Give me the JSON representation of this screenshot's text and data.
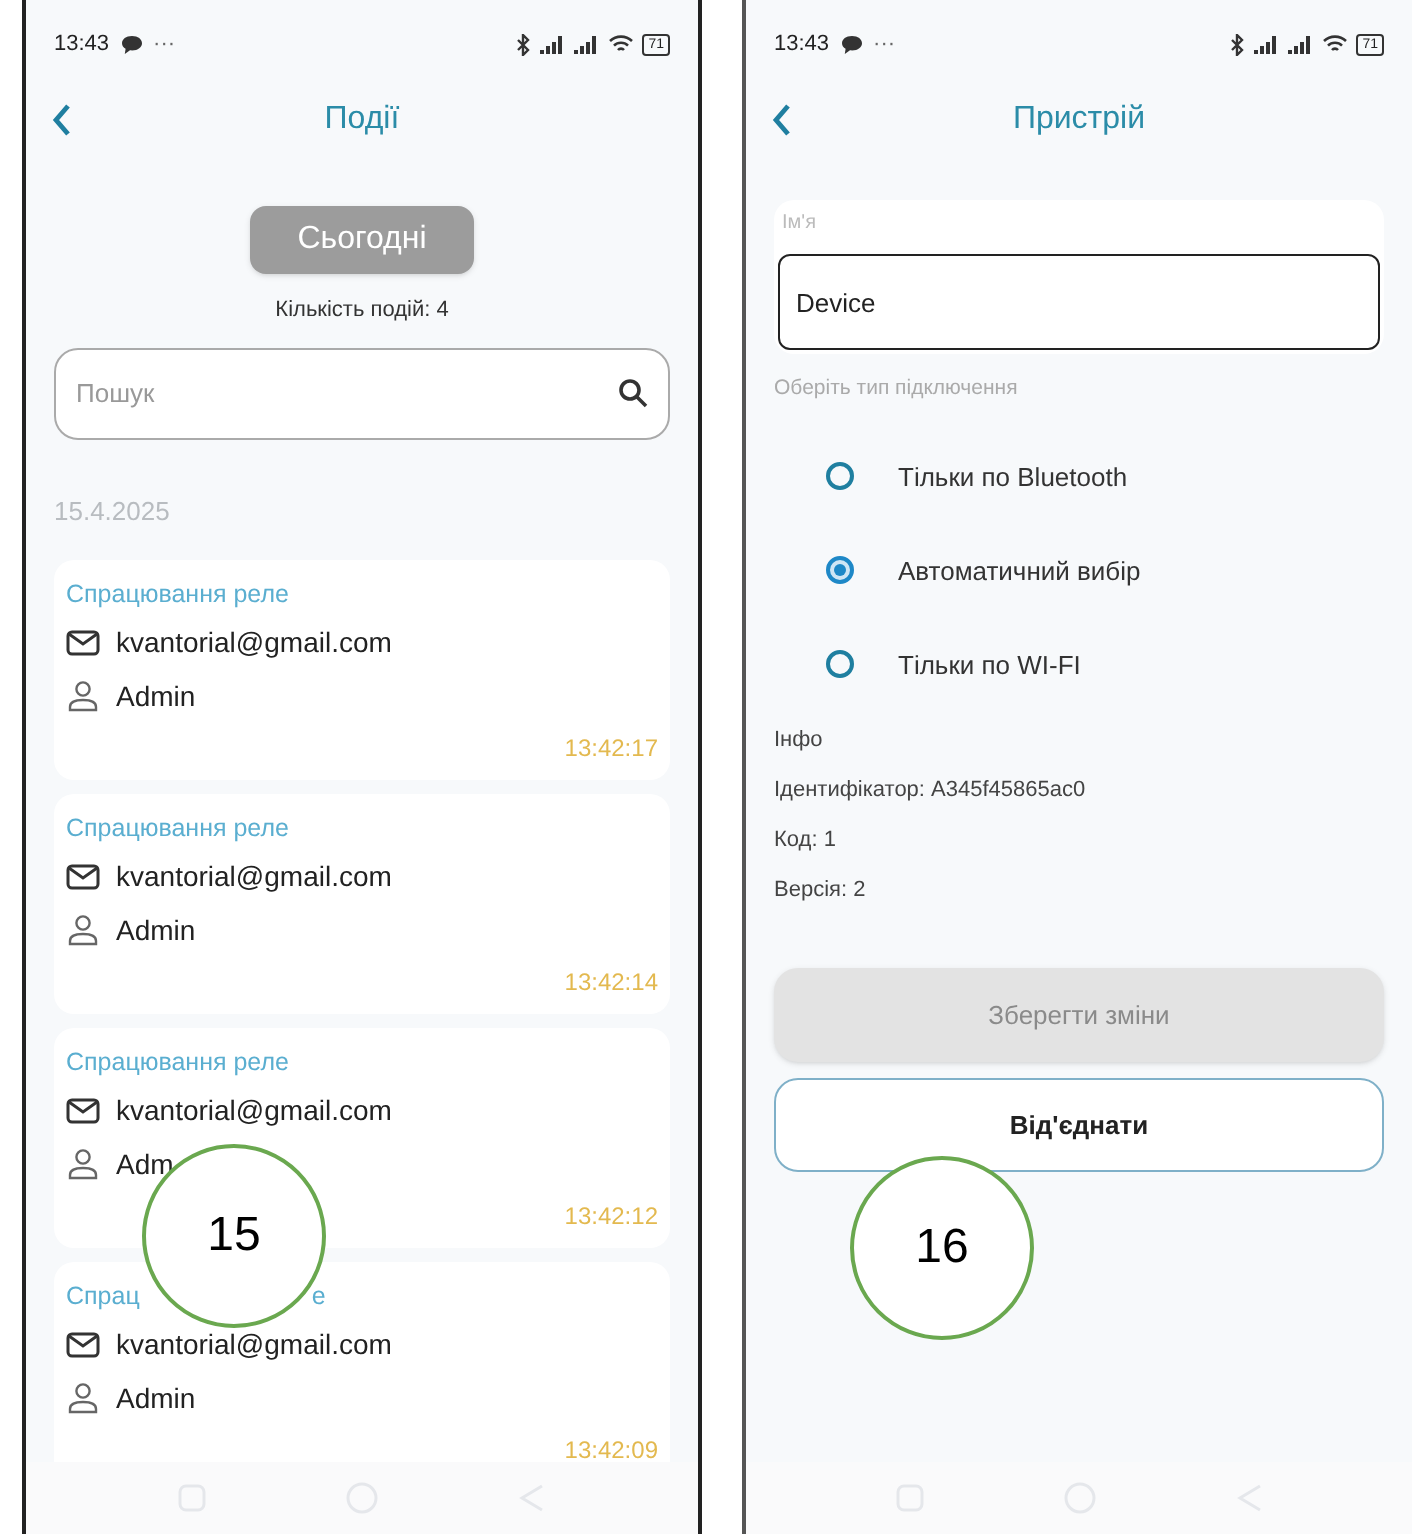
{
  "screens": [
    {
      "kind": "events",
      "status": {
        "time": "13:43",
        "more": "···",
        "battery": "71"
      },
      "title": "Події",
      "today_button": "Сьогодні",
      "count": "Кількість подій: 4",
      "search": {
        "placeholder": "Пошук"
      },
      "date": "15.4.2025",
      "events": [
        {
          "title": "Спрацювання реле",
          "email": "kvantorial@gmail.com",
          "user": "Admin",
          "time": "13:42:17"
        },
        {
          "title": "Спрацювання реле",
          "email": "kvantorial@gmail.com",
          "user": "Admin",
          "time": "13:42:14"
        },
        {
          "title": "Спрацювання реле",
          "email": "kvantorial@gmail.com",
          "user": "Adm",
          "time": "13:42:12"
        },
        {
          "title": "Спрац",
          "title_tail": "е",
          "email": "kvantorial@gmail.com",
          "user": "Admin",
          "time": "13:42:09"
        }
      ],
      "callout": "15"
    },
    {
      "kind": "device",
      "status": {
        "time": "13:43",
        "more": "···",
        "battery": "71"
      },
      "title": "Пристрій",
      "name_field": {
        "label": "Ім'я",
        "value": "Device"
      },
      "connection_label": "Оберіть тип підключення",
      "options": [
        {
          "label": "Тільки по Bluetooth",
          "selected": false
        },
        {
          "label": "Автоматичний вибір",
          "selected": true
        },
        {
          "label": "Тільки по WI-FI",
          "selected": false
        }
      ],
      "info": [
        "Інфо",
        "Ідентифікатор: A345f45865ac0",
        "Код: 1",
        "Версія: 2"
      ],
      "save_button": {
        "label": "Зберегти зміни",
        "disabled": true
      },
      "disconnect_button": "Від'єднати",
      "callout": "16"
    }
  ]
}
